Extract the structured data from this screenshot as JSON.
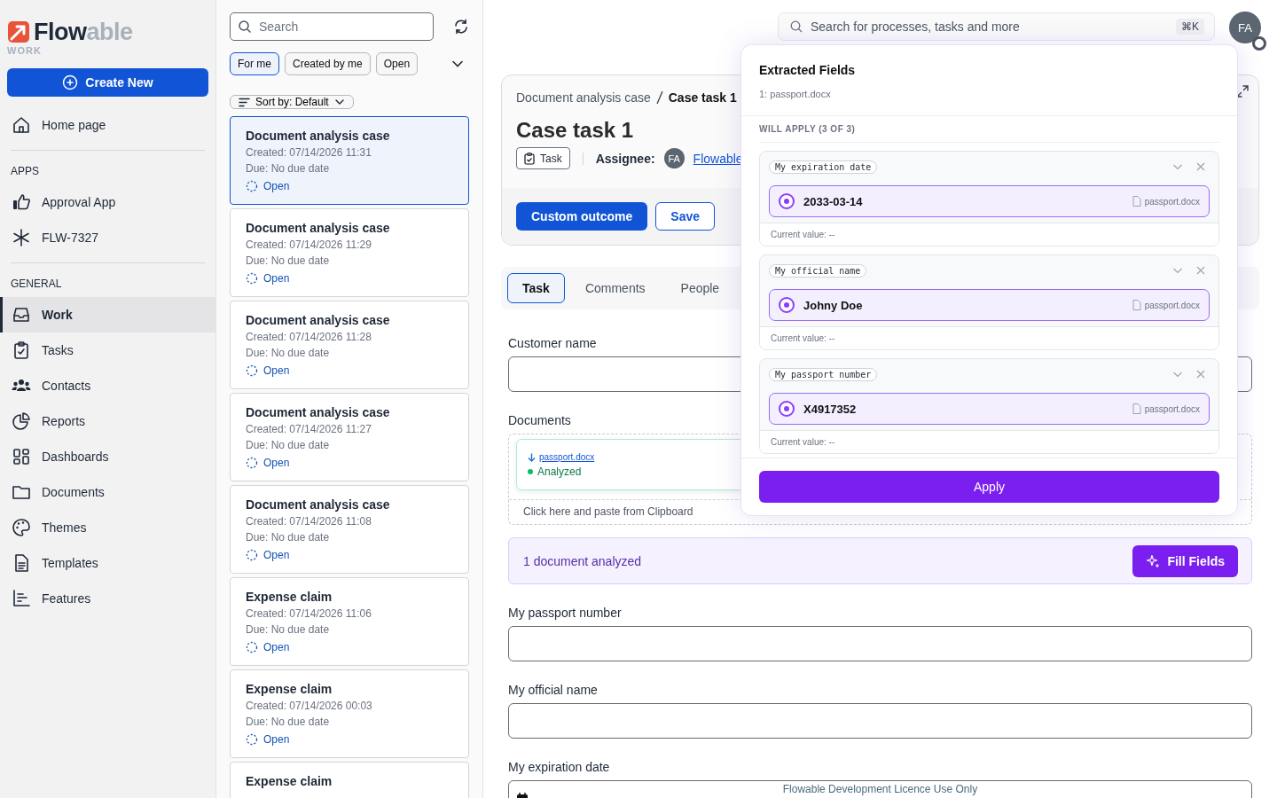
{
  "logo": {
    "name_dark": "Flow",
    "name_light": "able",
    "product": "WORK"
  },
  "create_button": "Create New",
  "sidebar": {
    "items": [
      {
        "kind": "item",
        "label": "Home page",
        "selected": false
      },
      {
        "kind": "divider"
      },
      {
        "kind": "heading",
        "label": "APPS"
      },
      {
        "kind": "item",
        "label": "Approval App",
        "selected": false
      },
      {
        "kind": "item",
        "label": "FLW-7327",
        "selected": false
      },
      {
        "kind": "divider"
      },
      {
        "kind": "heading",
        "label": "GENERAL"
      },
      {
        "kind": "item",
        "label": "Work",
        "selected": true
      },
      {
        "kind": "item",
        "label": "Tasks",
        "selected": false
      },
      {
        "kind": "item",
        "label": "Contacts",
        "selected": false
      },
      {
        "kind": "item",
        "label": "Reports",
        "selected": false
      },
      {
        "kind": "item",
        "label": "Dashboards",
        "selected": false
      },
      {
        "kind": "item",
        "label": "Documents",
        "selected": false
      },
      {
        "kind": "item",
        "label": "Themes",
        "selected": false
      },
      {
        "kind": "item",
        "label": "Templates",
        "selected": false
      },
      {
        "kind": "item",
        "label": "Features",
        "selected": false
      }
    ]
  },
  "work_list": {
    "search": {
      "placeholder": "Search"
    },
    "filters": [
      {
        "label": "For me",
        "selected": true
      },
      {
        "label": "Created by me",
        "selected": false
      },
      {
        "label": "Open",
        "selected": false
      }
    ],
    "sort": "Sort by: Default",
    "cards": [
      {
        "title": "Document analysis case",
        "created": "Created: 07/14/2026 11:31",
        "due": "Due: No due date",
        "status": "Open",
        "selected": true
      },
      {
        "title": "Document analysis case",
        "created": "Created: 07/14/2026 11:29",
        "due": "Due: No due date",
        "status": "Open",
        "selected": false
      },
      {
        "title": "Document analysis case",
        "created": "Created: 07/14/2026 11:28",
        "due": "Due: No due date",
        "status": "Open",
        "selected": false
      },
      {
        "title": "Document analysis case",
        "created": "Created: 07/14/2026 11:27",
        "due": "Due: No due date",
        "status": "Open",
        "selected": false
      },
      {
        "title": "Document analysis case",
        "created": "Created: 07/14/2026 11:08",
        "due": "Due: No due date",
        "status": "Open",
        "selected": false
      },
      {
        "title": "Expense claim",
        "created": "Created: 07/14/2026 11:06",
        "due": "Due: No due date",
        "status": "Open",
        "selected": false
      },
      {
        "title": "Expense claim",
        "created": "Created: 07/14/2026 00:03",
        "due": "Due: No due date",
        "status": "Open",
        "selected": false
      },
      {
        "title": "Expense claim"
      }
    ]
  },
  "top_bar": {
    "search": {
      "placeholder": "Search for processes, tasks and more",
      "shortcut": "⌘K"
    },
    "avatar": "FA"
  },
  "task": {
    "breadcrumb": [
      "Document analysis case",
      "Case task 1"
    ],
    "title": "Case task 1",
    "type": "Task",
    "assignee_label": "Assignee:",
    "assignee_avatar": "FA",
    "assignee": "Flowable",
    "actions": [
      {
        "label": "Custom outcome",
        "kind": "primary"
      },
      {
        "label": "Save",
        "kind": "secondary"
      }
    ],
    "tabs": [
      {
        "label": "Task",
        "selected": true
      },
      {
        "label": "Comments",
        "selected": false
      },
      {
        "label": "People",
        "selected": false
      }
    ]
  },
  "form": [
    {
      "kind": "text",
      "label": "Customer name"
    },
    {
      "kind": "documents",
      "label": "Documents",
      "file": "passport.docx",
      "status": "Analyzed",
      "paste_hint": "Click here and paste from Clipboard"
    },
    {
      "kind": "banner",
      "text": "1 document analyzed",
      "button": "Fill Fields"
    },
    {
      "kind": "text",
      "label": "My passport number"
    },
    {
      "kind": "text",
      "label": "My official name"
    },
    {
      "kind": "date",
      "label": "My expiration date"
    }
  ],
  "licence_note": "Flowable Development Licence Use Only",
  "extracted_fields": {
    "title": "Extracted Fields",
    "source": "1: passport.docx",
    "section": "WILL APPLY (3 OF 3)",
    "fields": [
      {
        "label": "My expiration date",
        "value": "2033-03-14",
        "file": "passport.docx",
        "current": "Current value: --",
        "selected": true
      },
      {
        "label": "My official name",
        "value": "Johny Doe",
        "file": "passport.docx",
        "current": "Current value: --",
        "selected": true
      },
      {
        "label": "My passport number",
        "value": "X4917352",
        "file": "passport.docx",
        "current": "Current value: --",
        "selected": true
      }
    ],
    "apply": "Apply"
  }
}
